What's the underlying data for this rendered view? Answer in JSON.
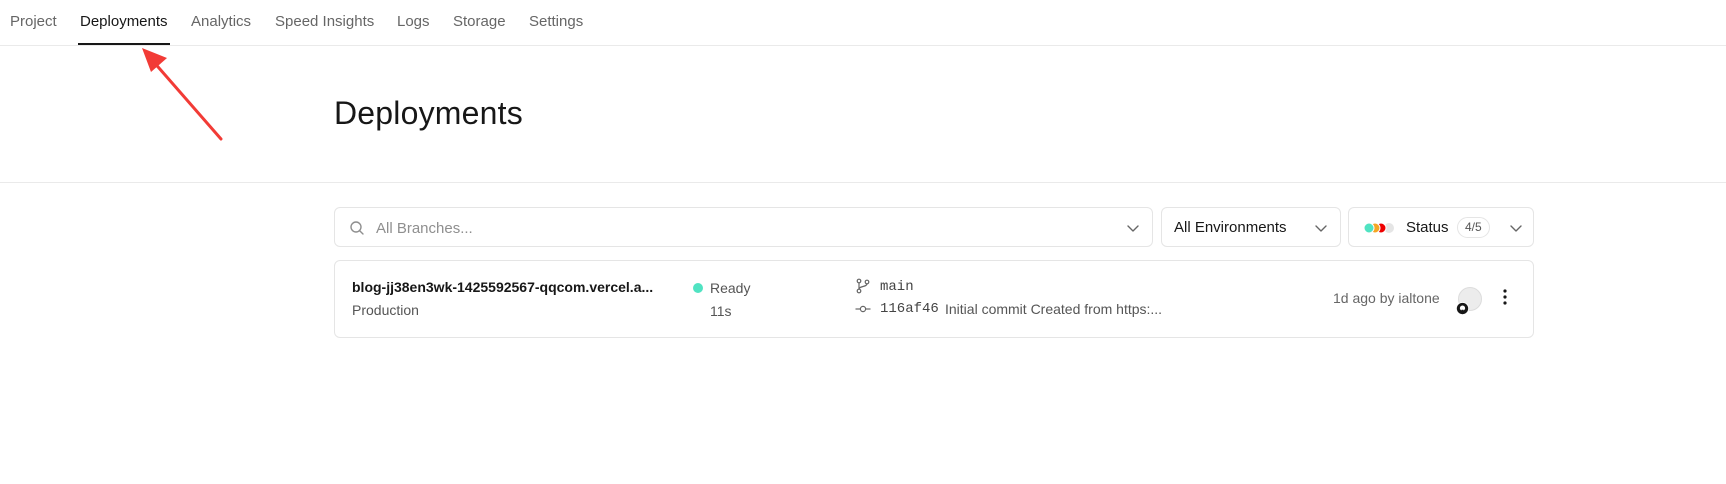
{
  "nav": {
    "tabs": [
      {
        "label": "Project"
      },
      {
        "label": "Deployments"
      },
      {
        "label": "Analytics"
      },
      {
        "label": "Speed Insights"
      },
      {
        "label": "Logs"
      },
      {
        "label": "Storage"
      },
      {
        "label": "Settings"
      }
    ],
    "active_tab": "Deployments"
  },
  "header": {
    "title": "Deployments"
  },
  "filters": {
    "branch_placeholder": "All Branches...",
    "environment": "All Environments",
    "status_label": "Status",
    "status_count": "4/5",
    "status_dot_colors": [
      "#50e3c2",
      "#f5a623",
      "#ee0000",
      "#e5e5e5"
    ]
  },
  "deployments": [
    {
      "url": "blog-jj38en3wk-1425592567-qqcom.vercel.a...",
      "environment": "Production",
      "status": "Ready",
      "status_color": "#50e3c2",
      "duration": "11s",
      "branch": "main",
      "commit_hash": "116af46",
      "commit_message": "Initial commit Created from https:...",
      "meta": "1d ago by ialtone"
    }
  ],
  "colors": {
    "annotation_arrow": "#f23b36",
    "border": "#e5e5e5",
    "text_primary": "#171717",
    "text_secondary": "#666666"
  },
  "icons": [
    "search-icon",
    "chevron-down-icon",
    "git-branch-icon",
    "git-commit-icon",
    "github-icon",
    "more-vertical-icon"
  ]
}
